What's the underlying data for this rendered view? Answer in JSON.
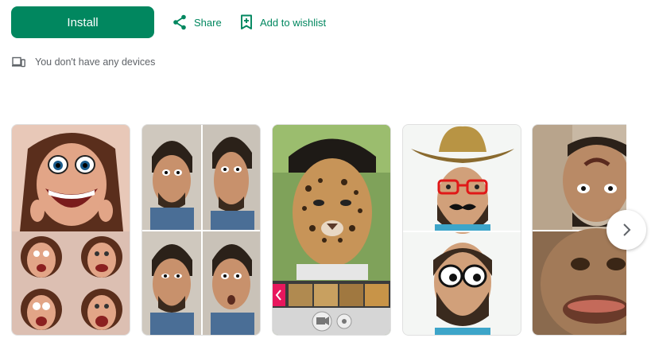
{
  "actions": {
    "install_label": "Install",
    "share_label": "Share",
    "wishlist_label": "Add to wishlist"
  },
  "devices_notice": "You don't have any devices",
  "icons": {
    "share": "share-icon",
    "wishlist": "bookmark-add-icon",
    "devices": "devices-icon",
    "next": "chevron-right-icon"
  },
  "screenshots": [
    {
      "description": "woman with big cartoon eyes and exaggerated grin, plus four distorted face variants"
    },
    {
      "description": "man's face in four distorted variants"
    },
    {
      "description": "man with leopard face filter over camera UI with animal filter thumbnails"
    },
    {
      "description": "bearded man with cowboy hat, red glasses and mustache, plus cartoon eyes"
    },
    {
      "description": "upside-down distorted face and stretched face close-up"
    }
  ],
  "colors": {
    "accent": "#01875f",
    "text_secondary": "#5f6368"
  }
}
